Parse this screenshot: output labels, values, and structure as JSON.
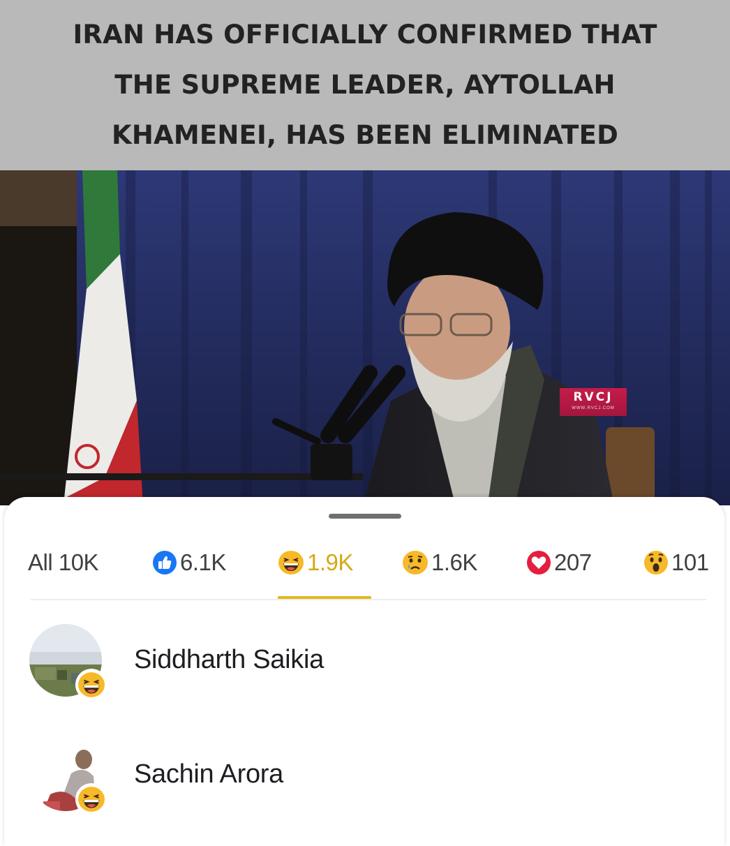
{
  "headline": {
    "lines": [
      "IRAN HAS OFFICIALLY CONFIRMED THAT",
      "THE SUPREME LEADER, AYTOLLAH",
      "KHAMENEI, HAS BEEN ELIMINATED"
    ]
  },
  "photo": {
    "watermark": "RVCJ",
    "watermark_sub": "WWW.RVCJ.COM"
  },
  "reactions": {
    "tabs": [
      {
        "label": "All 10K",
        "icon": "none",
        "active": false
      },
      {
        "label": "6.1K",
        "icon": "like-icon",
        "active": false
      },
      {
        "label": "1.9K",
        "icon": "haha-icon",
        "active": true
      },
      {
        "label": "1.6K",
        "icon": "sad-icon",
        "active": false
      },
      {
        "label": "207",
        "icon": "love-icon",
        "active": false
      },
      {
        "label": "101",
        "icon": "wow-icon",
        "active": false
      }
    ],
    "list": [
      {
        "name": "Siddharth Saikia",
        "reaction_icon": "haha-icon"
      },
      {
        "name": "Sachin Arora",
        "reaction_icon": "haha-icon"
      }
    ]
  },
  "colors": {
    "headline_band": "#b9b9b9",
    "active_tab": "#d6a814",
    "like_blue": "#1877f2",
    "love_red": "#e41e3f",
    "emoji_yellow": "#f7b928"
  }
}
